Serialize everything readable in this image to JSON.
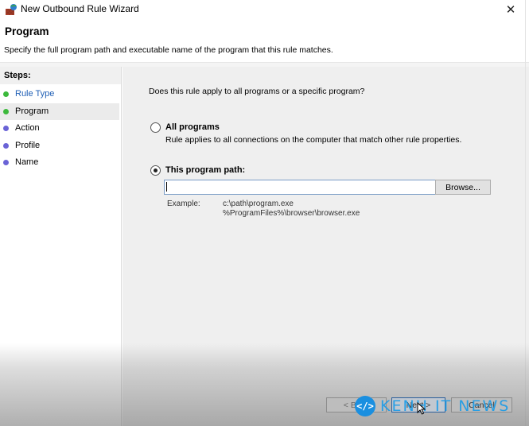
{
  "window": {
    "title": "New Outbound Rule Wizard",
    "icon": "firewall-icon",
    "close_glyph": "✕"
  },
  "header": {
    "title": "Program",
    "subtitle": "Specify the full program path and executable name of the program that this rule matches."
  },
  "sidebar": {
    "steps_label": "Steps:",
    "steps": [
      {
        "label": "Rule Type",
        "state": "completed",
        "dot_color": "#3cb93c",
        "is_link": true
      },
      {
        "label": "Program",
        "state": "current",
        "dot_color": "#3cb93c",
        "is_link": false
      },
      {
        "label": "Action",
        "state": "pending",
        "dot_color": "#6a63d6",
        "is_link": false
      },
      {
        "label": "Profile",
        "state": "pending",
        "dot_color": "#6a63d6",
        "is_link": false
      },
      {
        "label": "Name",
        "state": "pending",
        "dot_color": "#6a63d6",
        "is_link": false
      }
    ]
  },
  "main": {
    "question": "Does this rule apply to all programs or a specific program?",
    "options": [
      {
        "label": "All programs",
        "description": "Rule applies to all connections on the computer that match other rule properties.",
        "checked": false
      },
      {
        "label": "This program path:",
        "checked": true
      }
    ],
    "path_input": {
      "value": "",
      "placeholder": ""
    },
    "browse_label": "Browse...",
    "example_label": "Example:",
    "example_lines": [
      "c:\\path\\program.exe",
      "%ProgramFiles%\\browser\\browser.exe"
    ]
  },
  "footer": {
    "back_label": "< Back",
    "next_label": "Next >",
    "cancel_label": "Cancel"
  },
  "watermark": {
    "logo_glyph": "</>",
    "text": "KENH IT NEWS"
  }
}
